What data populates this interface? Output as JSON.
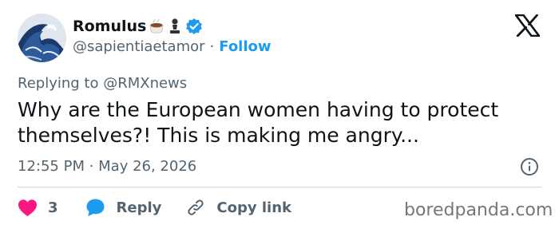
{
  "user": {
    "display_name": "Romulus",
    "handle": "@sapientiaetamor",
    "separator": "·",
    "follow_label": "Follow",
    "avatar": "wave-painting-avatar",
    "name_emojis": [
      "coffee-emoji-icon",
      "chess-pawn-emoji-icon"
    ],
    "verified": true
  },
  "tweet": {
    "replying_prefix": "Replying to ",
    "replying_to": "@RMXnews",
    "text": "Why are the European women having to protect themselves?! This is making me angry...",
    "timestamp": "12:55 PM · May 26, 2026"
  },
  "actions": {
    "like_count": "3",
    "reply_label": "Reply",
    "copy_label": "Copy link"
  },
  "watermark": "boredpanda.com",
  "colors": {
    "accent": "#1d9bf0",
    "like": "#f91880",
    "text": "#0f1419",
    "secondary": "#536471",
    "divider": "#cfd9de"
  }
}
